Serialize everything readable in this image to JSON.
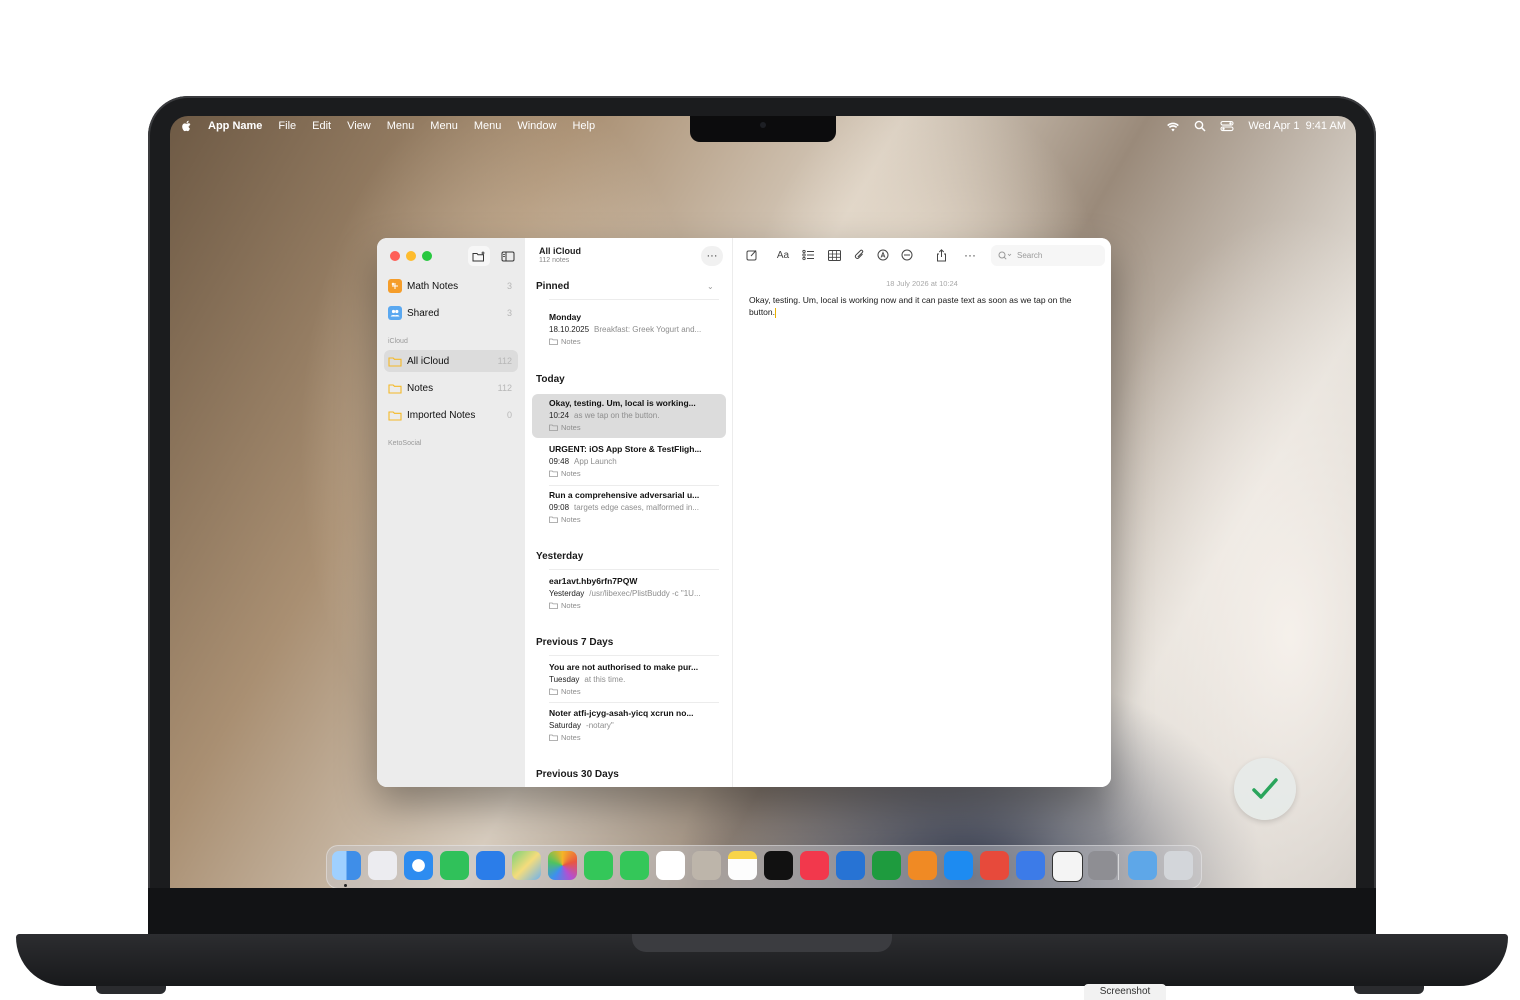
{
  "menubar": {
    "app_name": "App Name",
    "menus": [
      "File",
      "Edit",
      "View",
      "Menu",
      "Menu",
      "Menu",
      "Window",
      "Help"
    ],
    "date_time": "Wed Apr 1  9:41 AM"
  },
  "sidebar": {
    "top_items": [
      {
        "label": "Math Notes",
        "count": "3"
      },
      {
        "label": "Shared",
        "count": "3"
      }
    ],
    "section_icloud": "iCloud",
    "icloud_items": [
      {
        "label": "All iCloud",
        "count": "112"
      },
      {
        "label": "Notes",
        "count": "112"
      },
      {
        "label": "Imported Notes",
        "count": "0"
      }
    ],
    "section_other": "KetoSocial"
  },
  "list": {
    "title": "All iCloud",
    "subtitle": "112 notes",
    "groups": {
      "pinned": "Pinned",
      "today": "Today",
      "yesterday": "Yesterday",
      "prev7": "Previous 7 Days",
      "prev30": "Previous 30 Days"
    },
    "notes": [
      {
        "title": "Monday",
        "date": "18.10.2025",
        "preview": "Breakfast: Greek Yogurt and...",
        "folder": "Notes"
      },
      {
        "title": "Okay, testing. Um, local is working...",
        "date": "10:24",
        "preview": "as we tap on the button.",
        "folder": "Notes"
      },
      {
        "title": "URGENT: iOS App Store & TestFligh...",
        "date": "09:48",
        "preview": "App Launch",
        "folder": "Notes"
      },
      {
        "title": "Run a comprehensive adversarial u...",
        "date": "09:08",
        "preview": "targets edge cases, malformed in...",
        "folder": "Notes"
      },
      {
        "title": "ear1avt.hby6rfn7PQW",
        "date": "Yesterday",
        "preview": "/usr/libexec/PlistBuddy -c \"1U...",
        "folder": "Notes"
      },
      {
        "title": "You are not authorised to make pur...",
        "date": "Tuesday",
        "preview": "at this time.",
        "folder": "Notes"
      },
      {
        "title": "Noter atfi-jcyg-asah-yicq xcrun no...",
        "date": "Saturday",
        "preview": "-notary\"",
        "folder": "Notes"
      }
    ]
  },
  "editor": {
    "search_placeholder": "Search",
    "date": "18 July 2026 at 10:24",
    "body": "Okay, testing. Um, local is working now and it can paste text as soon as we tap on the button."
  },
  "screenshot_label": "Screenshot",
  "colors": {
    "accent_folder": "#f5b927",
    "traffic_red": "#fe5f57",
    "traffic_yellow": "#febc2e",
    "traffic_green": "#28c840",
    "checkmark": "#2aa55c"
  }
}
